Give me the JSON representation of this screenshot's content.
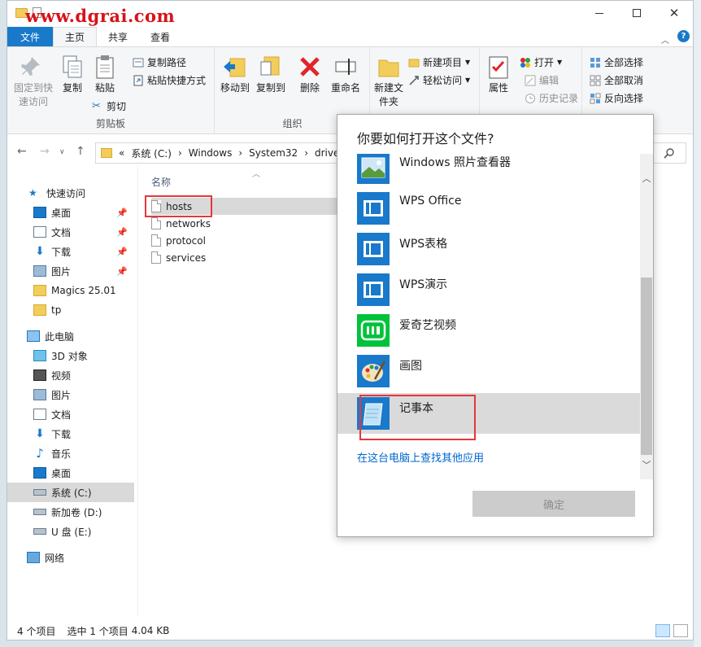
{
  "titlebar": {
    "watermark": "www.dgrai.com"
  },
  "tabs": {
    "file": "文件",
    "home": "主页",
    "share": "共享",
    "view": "查看"
  },
  "ribbon": {
    "pin": "固定到快速访问",
    "copy": "复制",
    "paste": "粘贴",
    "copy_path": "复制路径",
    "paste_shortcut": "粘贴快捷方式",
    "cut": "剪切",
    "clipboard_group": "剪贴板",
    "move_to": "移动到",
    "copy_to": "复制到",
    "delete": "删除",
    "rename": "重命名",
    "organize_group": "组织",
    "new_folder": "新建文件夹",
    "new_item": "新建项目",
    "easy_access": "轻松访问",
    "open": "打开",
    "edit": "编辑",
    "history": "历史记录",
    "properties": "属性",
    "select_all": "全部选择",
    "select_none": "全部取消",
    "invert_selection": "反向选择"
  },
  "address": {
    "sep": "«",
    "parts": [
      "系统 (C:)",
      "Windows",
      "System32",
      "drive"
    ]
  },
  "navpane": {
    "quick_access": "快速访问",
    "desktop": "桌面",
    "documents": "文档",
    "downloads": "下载",
    "pictures": "图片",
    "magics": "Magics 25.01",
    "tp": "tp",
    "this_pc": "此电脑",
    "objects3d": "3D 对象",
    "videos": "视频",
    "pictures2": "图片",
    "documents2": "文档",
    "downloads2": "下载",
    "music": "音乐",
    "desktop2": "桌面",
    "drive_c": "系统 (C:)",
    "drive_d": "新加卷 (D:)",
    "drive_e": "U 盘 (E:)",
    "network": "网络"
  },
  "filelist": {
    "col_name": "名称",
    "files": [
      "hosts",
      "networks",
      "protocol",
      "services"
    ]
  },
  "statusbar": {
    "count": "4 个项目",
    "selected": "选中 1 个项目",
    "size": "4.04 KB"
  },
  "dialog": {
    "title": "你要如何打开这个文件?",
    "apps": [
      "Windows 照片查看器",
      "WPS Office",
      "WPS表格",
      "WPS演示",
      "爱奇艺视频",
      "画图",
      "记事本"
    ],
    "more_link": "在这台电脑上查找其他应用",
    "ok": "确定"
  },
  "colors": {
    "accent": "#1979ca",
    "highlight_border": "#e6373a",
    "watermark": "#d8121a"
  }
}
